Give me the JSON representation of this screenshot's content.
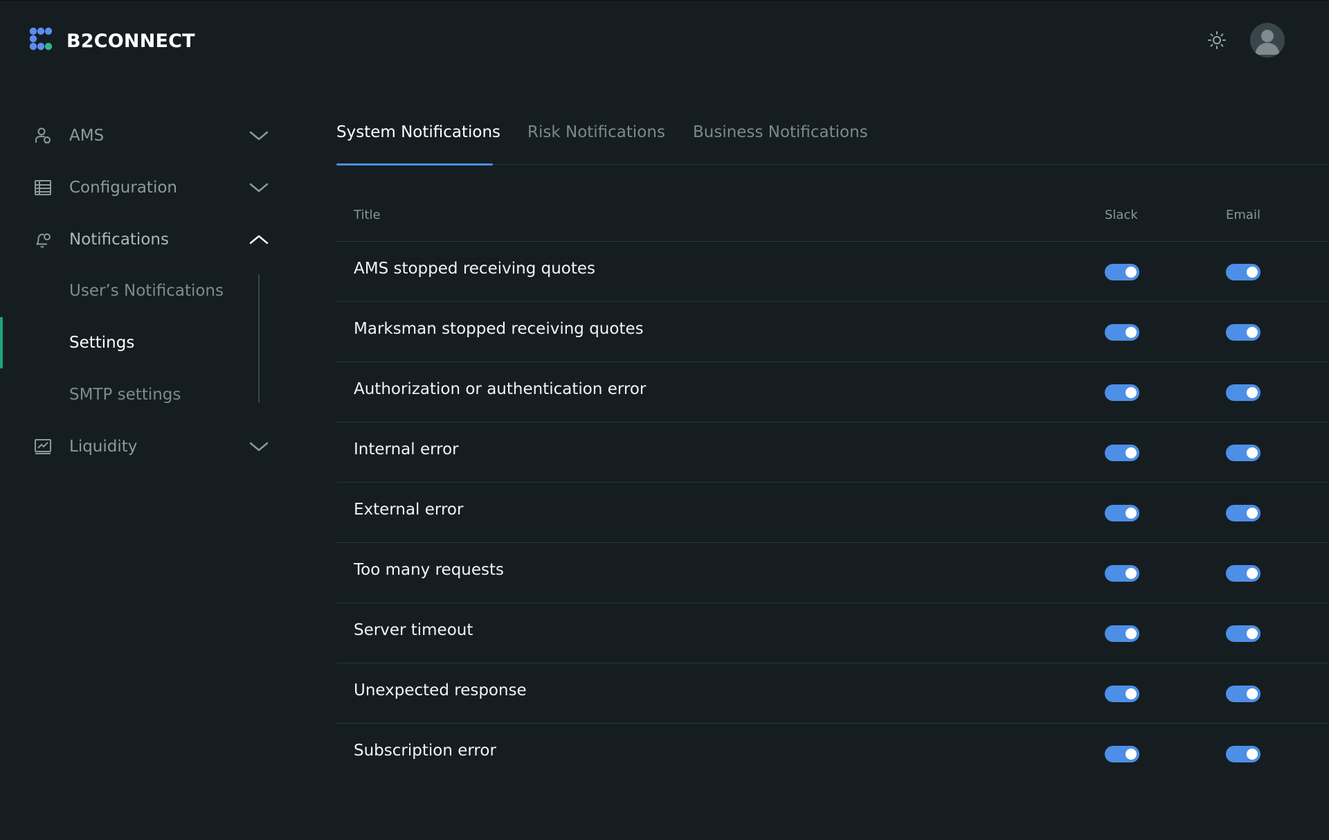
{
  "brand": {
    "name": "B2CONNECT"
  },
  "header": {
    "theme_icon": "sun-icon",
    "avatar_icon": "user-avatar-icon"
  },
  "sidebar": {
    "items": [
      {
        "label": "AMS",
        "icon": "users-icon",
        "expanded": false
      },
      {
        "label": "Configuration",
        "icon": "table-icon",
        "expanded": false
      },
      {
        "label": "Notifications",
        "icon": "bell-icon",
        "expanded": true,
        "children": [
          {
            "label": "User’s Notifications",
            "active": false
          },
          {
            "label": "Settings",
            "active": true
          },
          {
            "label": "SMTP settings",
            "active": false
          }
        ]
      },
      {
        "label": "Liquidity",
        "icon": "chart-icon",
        "expanded": false
      }
    ]
  },
  "tabs": [
    {
      "label": "System Notifications",
      "active": true
    },
    {
      "label": "Risk Notifications",
      "active": false
    },
    {
      "label": "Business Notifications",
      "active": false
    }
  ],
  "table": {
    "columns": {
      "title": "Title",
      "slack": "Slack",
      "email": "Email"
    },
    "rows": [
      {
        "title": "AMS stopped receiving quotes",
        "slack": true,
        "email": true
      },
      {
        "title": "Marksman stopped receiving quotes",
        "slack": true,
        "email": true
      },
      {
        "title": "Authorization or authentication error",
        "slack": true,
        "email": true
      },
      {
        "title": "Internal error",
        "slack": true,
        "email": true
      },
      {
        "title": "External error",
        "slack": true,
        "email": true
      },
      {
        "title": "Too many requests",
        "slack": true,
        "email": true
      },
      {
        "title": "Server timeout",
        "slack": true,
        "email": true
      },
      {
        "title": "Unexpected response",
        "slack": true,
        "email": true
      },
      {
        "title": "Subscription error",
        "slack": true,
        "email": true
      }
    ]
  },
  "colors": {
    "background": "#151d21",
    "accent": "#4d8fe6",
    "active_marker": "#1fa378"
  }
}
